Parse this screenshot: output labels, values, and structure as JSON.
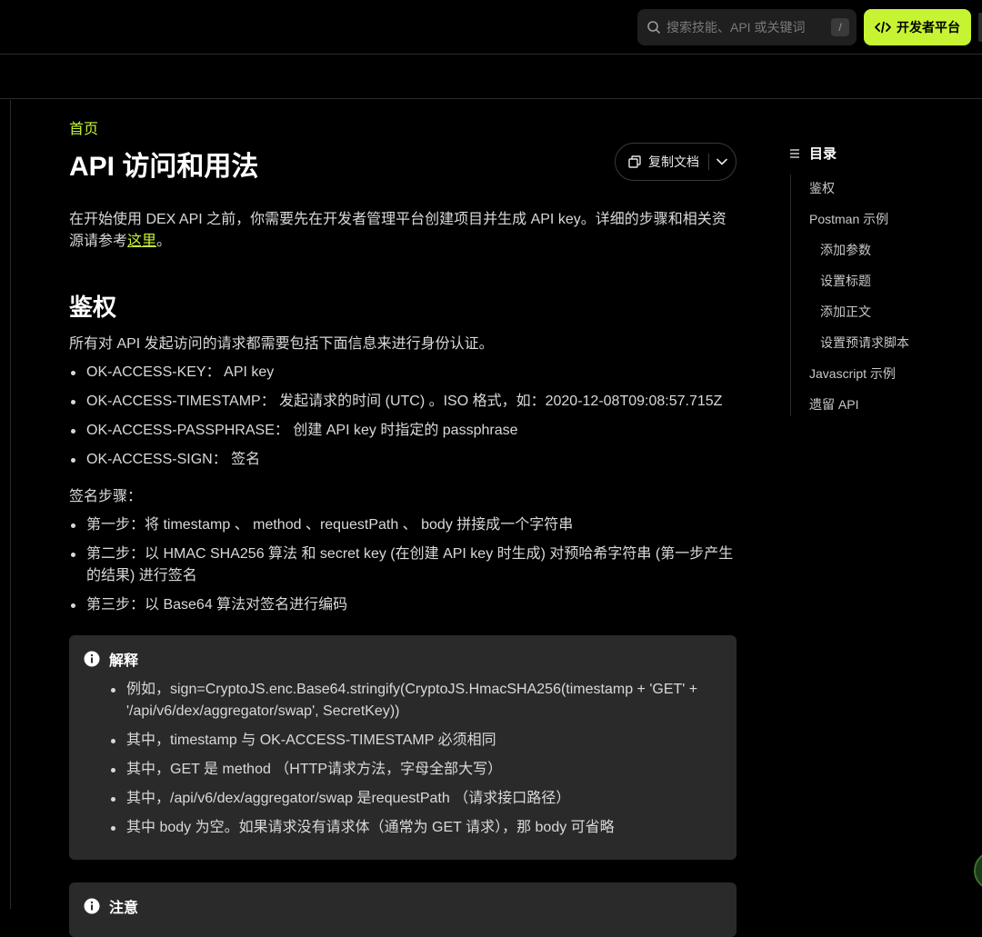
{
  "header": {
    "search_placeholder": "搜索技能、API 或关键词",
    "search_shortcut": "/",
    "developer_button": "开发者平台"
  },
  "breadcrumb": "首页",
  "page_title": "API 访问和用法",
  "copy_button": "复制文档",
  "intro": {
    "text_before": "在开始使用 DEX API 之前，你需要先在开发者管理平台创建项目并生成 API key。详细的步骤和相关资源请参考",
    "link": "这里",
    "text_after": "。"
  },
  "section_auth": {
    "heading": "鉴权",
    "desc": "所有对 API 发起访问的请求都需要包括下面信息来进行身份认证。",
    "headers": [
      "OK-ACCESS-KEY： API key",
      "OK-ACCESS-TIMESTAMP： 发起请求的时间 (UTC) 。ISO 格式，如：2020-12-08T09:08:57.715Z",
      "OK-ACCESS-PASSPHRASE： 创建 API key 时指定的 passphrase",
      "OK-ACCESS-SIGN： 签名"
    ],
    "steps_label": "签名步骤：",
    "steps": [
      "第一步：将 timestamp 、 method 、requestPath 、 body 拼接成一个字符串",
      "第二步：以 HMAC SHA256 算法 和 secret key (在创建 API key 时生成) 对预哈希字符串 (第一步产生的结果) 进行签名",
      "第三步：以 Base64 算法对签名进行编码"
    ]
  },
  "callout_explain": {
    "title": "解释",
    "items": [
      "例如，sign=CryptoJS.enc.Base64.stringify(CryptoJS.HmacSHA256(timestamp + 'GET' + '/api/v6/dex/aggregator/swap', SecretKey))",
      "其中，timestamp 与 OK-ACCESS-TIMESTAMP 必须相同",
      "其中，GET 是 method （HTTP请求方法，字母全部大写）",
      "其中，/api/v6/dex/aggregator/swap 是requestPath （请求接口路径）",
      "其中 body 为空。如果请求没有请求体（通常为 GET 请求），那 body 可省略"
    ]
  },
  "callout_note": {
    "title": "注意"
  },
  "toc": {
    "title": "目录",
    "items": [
      {
        "label": "鉴权",
        "sub": false
      },
      {
        "label": "Postman 示例",
        "sub": false
      },
      {
        "label": "添加参数",
        "sub": true
      },
      {
        "label": "设置标题",
        "sub": true
      },
      {
        "label": "添加正文",
        "sub": true
      },
      {
        "label": "设置预请求脚本",
        "sub": true
      },
      {
        "label": "Javascript 示例",
        "sub": false
      },
      {
        "label": "遗留 API",
        "sub": false
      }
    ]
  },
  "colors": {
    "accent": "#c6f432",
    "background": "#000000",
    "callout_bg": "#2a2a2a"
  }
}
